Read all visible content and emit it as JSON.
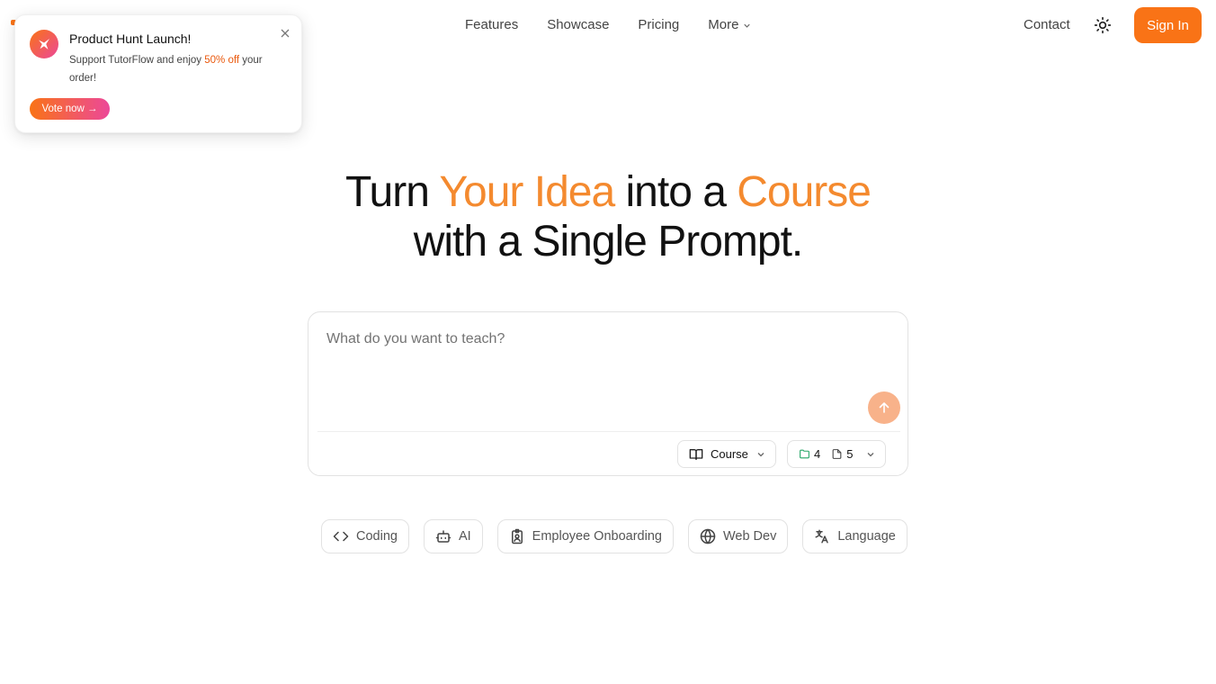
{
  "nav": {
    "links": [
      {
        "label": "Features"
      },
      {
        "label": "Showcase"
      },
      {
        "label": "Pricing"
      },
      {
        "label": "More"
      }
    ],
    "contact": "Contact",
    "sign_in": "Sign In",
    "theme_icon": "sun-icon"
  },
  "popup": {
    "title": "Product Hunt Launch!",
    "text_before": "Support TutorFlow and enjoy ",
    "text_highlight": "50% off",
    "text_after": " your order!",
    "button": "Vote now →",
    "icon": "product-hunt-cat-icon"
  },
  "hero": {
    "line1_part1": "Turn ",
    "line1_accent1": "Your Idea",
    "line1_part2": " into a ",
    "line1_accent2": "Course",
    "line2": "with a Single Prompt."
  },
  "prompt": {
    "placeholder": "What do you want to teach?",
    "value": "",
    "type_selector": "Course",
    "modules_count": "4",
    "lessons_count": "5"
  },
  "suggestions": [
    {
      "label": "Coding",
      "icon": "code-icon"
    },
    {
      "label": "AI",
      "icon": "bot-icon"
    },
    {
      "label": "Employee Onboarding",
      "icon": "badge-icon"
    },
    {
      "label": "Web Dev",
      "icon": "globe-icon"
    },
    {
      "label": "Language",
      "icon": "translate-icon"
    }
  ],
  "colors": {
    "accent": "#f97316",
    "hero_accent": "#f48a2f",
    "send_button": "#f8b28a",
    "gradient_end": "#ec4899"
  }
}
